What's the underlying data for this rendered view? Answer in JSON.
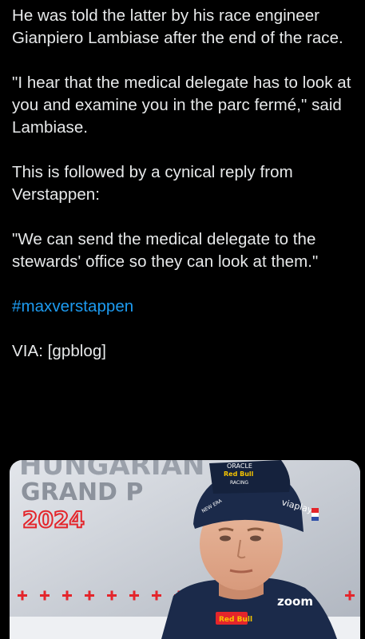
{
  "tweet": {
    "paragraph_1": "He was told the latter by his race engineer Gianpiero Lambiase after the end of the race.",
    "paragraph_2": "\"I hear that the medical delegate has to look at you and examine you in the parc fermé,\" said Lambiase.",
    "paragraph_3": "This is followed by a cynical reply from Verstappen:",
    "paragraph_4": "\"We can send the medical delegate to the stewards' office so they can look at them.\"",
    "hashtag": "#maxverstappen",
    "source": "VIA: [gpblog]"
  },
  "media": {
    "backdrop_line_1": "HUNGARIAN",
    "backdrop_line_2": "GRAND P",
    "backdrop_line_3": "2024",
    "cap_brand_1": "ORACLE",
    "cap_brand_2": "Red Bull",
    "cap_brand_3": "RACING",
    "cap_brand_4": "NEW ERA",
    "cap_sponsor": "viaplay",
    "shirt_sponsor": "zoom",
    "shirt_logo": "Red Bull",
    "backdrop_color": "#c7ccd4",
    "cap_color": "#1b2a4a",
    "accent_red": "#e4252b"
  }
}
